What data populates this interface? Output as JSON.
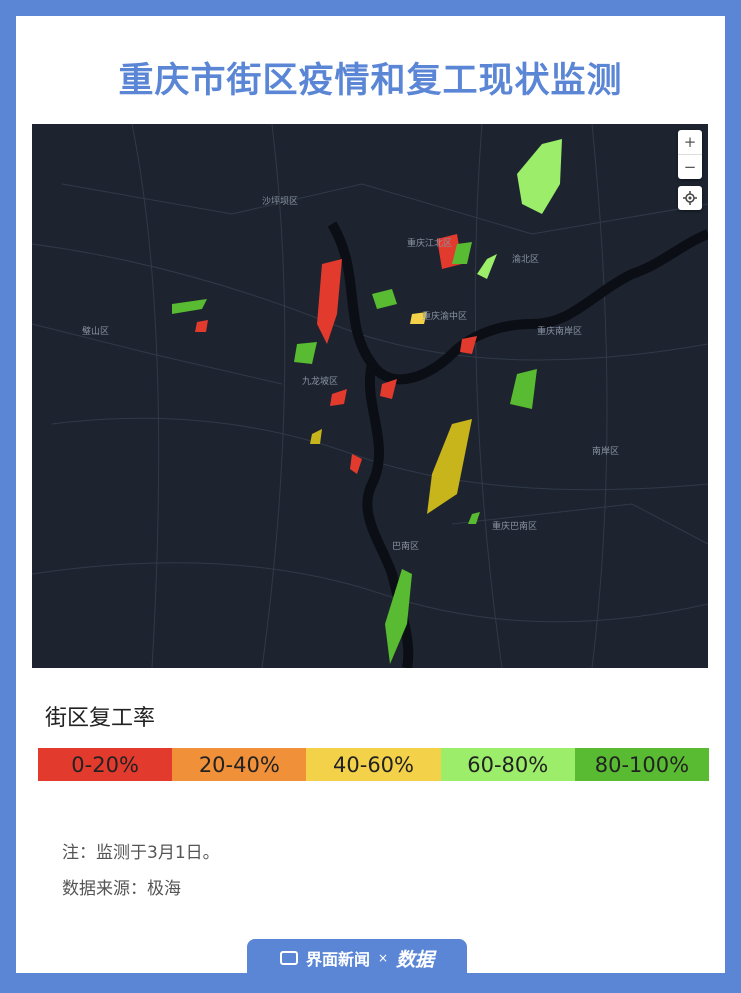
{
  "title": "重庆市街区疫情和复工现状监测",
  "map": {
    "zoom_in_label": "+",
    "zoom_out_label": "−",
    "locate_icon": "target-icon",
    "place_labels": [
      "重庆江北区",
      "重庆渝中区",
      "渝北区",
      "九龙坡区",
      "巴南区",
      "重庆南岸区",
      "璧山区",
      "沙坪坝区",
      "重庆巴南区",
      "南岸区"
    ]
  },
  "legend": {
    "title": "街区复工率",
    "items": [
      {
        "label": "0-20%",
        "color": "#e33a2e"
      },
      {
        "label": "20-40%",
        "color": "#f0913a"
      },
      {
        "label": "40-60%",
        "color": "#f3d24a"
      },
      {
        "label": "60-80%",
        "color": "#9bed6a"
      },
      {
        "label": "80-100%",
        "color": "#58bb31"
      }
    ]
  },
  "notes": {
    "date_note": "注：监测于3月1日。",
    "source_note": "数据来源：极海"
  },
  "footer": {
    "brand_label": "界面新闻",
    "separator": "×",
    "partner_label": "数据"
  }
}
